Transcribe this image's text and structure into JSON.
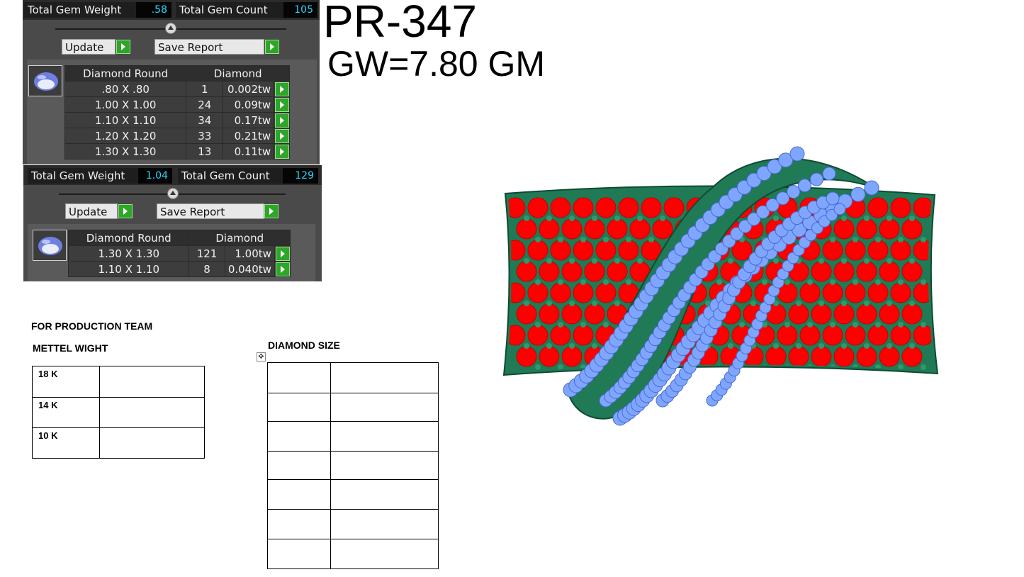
{
  "panel1": {
    "weight_label": "Total Gem Weight",
    "weight_value": ".58",
    "count_label": "Total Gem Count",
    "count_value": "105",
    "update_label": "Update",
    "save_label": "Save Report",
    "table_head": [
      "Diamond Round",
      "Diamond"
    ],
    "rows": [
      {
        "size": ".80 X .80",
        "qty": "1",
        "tw": "0.002tw"
      },
      {
        "size": "1.00 X 1.00",
        "qty": "24",
        "tw": "0.09tw"
      },
      {
        "size": "1.10 X 1.10",
        "qty": "34",
        "tw": "0.17tw"
      },
      {
        "size": "1.20 X 1.20",
        "qty": "33",
        "tw": "0.21tw"
      },
      {
        "size": "1.30 X 1.30",
        "qty": "13",
        "tw": "0.11tw"
      }
    ]
  },
  "panel2": {
    "weight_label": "Total Gem Weight",
    "weight_value": "1.04",
    "count_label": "Total Gem Count",
    "count_value": "129",
    "update_label": "Update",
    "save_label": "Save Report",
    "table_head": [
      "Diamond Round",
      "Diamond"
    ],
    "rows": [
      {
        "size": "1.30 X 1.30",
        "qty": "121",
        "tw": "1.00tw"
      },
      {
        "size": "1.10 X 1.10",
        "qty": "8",
        "tw": "0.040tw"
      }
    ]
  },
  "title": "PR-347",
  "gross_weight": "GW=7.80 GM",
  "production": {
    "heading": "FOR PRODUCTION TEAM",
    "metal_heading": "METTEL WIGHT",
    "metal_rows": [
      "18 K",
      "14 K",
      "10 K"
    ],
    "diamond_heading": "DIAMOND SIZE"
  },
  "colors": {
    "panel_bg": "#4a4a4a",
    "value_text": "#27d7ff",
    "go_button": "#2fa52a",
    "ring_metal": "#1f7a55",
    "ring_red_stones": "#ff0000",
    "ring_blue_stones": "#7fa6ff",
    "ring_purple_accents": "#7a3fbf"
  },
  "icons": [
    "gem-oval-icon",
    "play-arrow-icon",
    "slider-knob-icon",
    "move-handle-icon"
  ]
}
